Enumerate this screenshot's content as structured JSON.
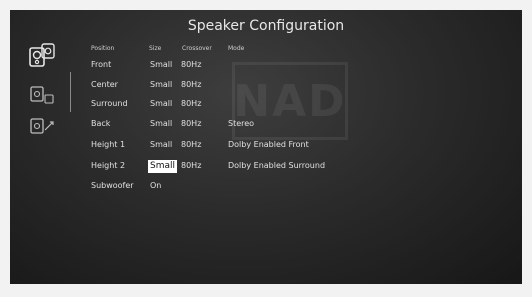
{
  "title": "Speaker Configuration",
  "logo_text": "NAD",
  "sidebar": [
    {
      "icon": "speaker-icon",
      "selected": true
    },
    {
      "icon": "room-settings-icon",
      "selected": false
    },
    {
      "icon": "tv-audio-icon",
      "selected": false
    }
  ],
  "table": {
    "headers": {
      "position": "Position",
      "size": "Size",
      "crossover": "Crossover",
      "mode": "Mode"
    },
    "rows": [
      {
        "position": "Front",
        "size": "Small",
        "crossover": "80Hz",
        "mode": ""
      },
      {
        "position": "Center",
        "size": "Small",
        "crossover": "80Hz",
        "mode": ""
      },
      {
        "position": "Surround",
        "size": "Small",
        "crossover": "80Hz",
        "mode": ""
      },
      {
        "position": "Back",
        "size": "Small",
        "crossover": "80Hz",
        "mode": "Stereo"
      },
      {
        "position": "Height 1",
        "size": "Small",
        "crossover": "80Hz",
        "mode": "Dolby Enabled Front"
      },
      {
        "position": "Height 2",
        "size": "Small",
        "crossover": "80Hz",
        "mode": "Dolby Enabled Surround"
      },
      {
        "position": "Subwoofer",
        "size": "On",
        "crossover": "",
        "mode": ""
      }
    ],
    "selected_cell": "Height 2 / Size"
  }
}
